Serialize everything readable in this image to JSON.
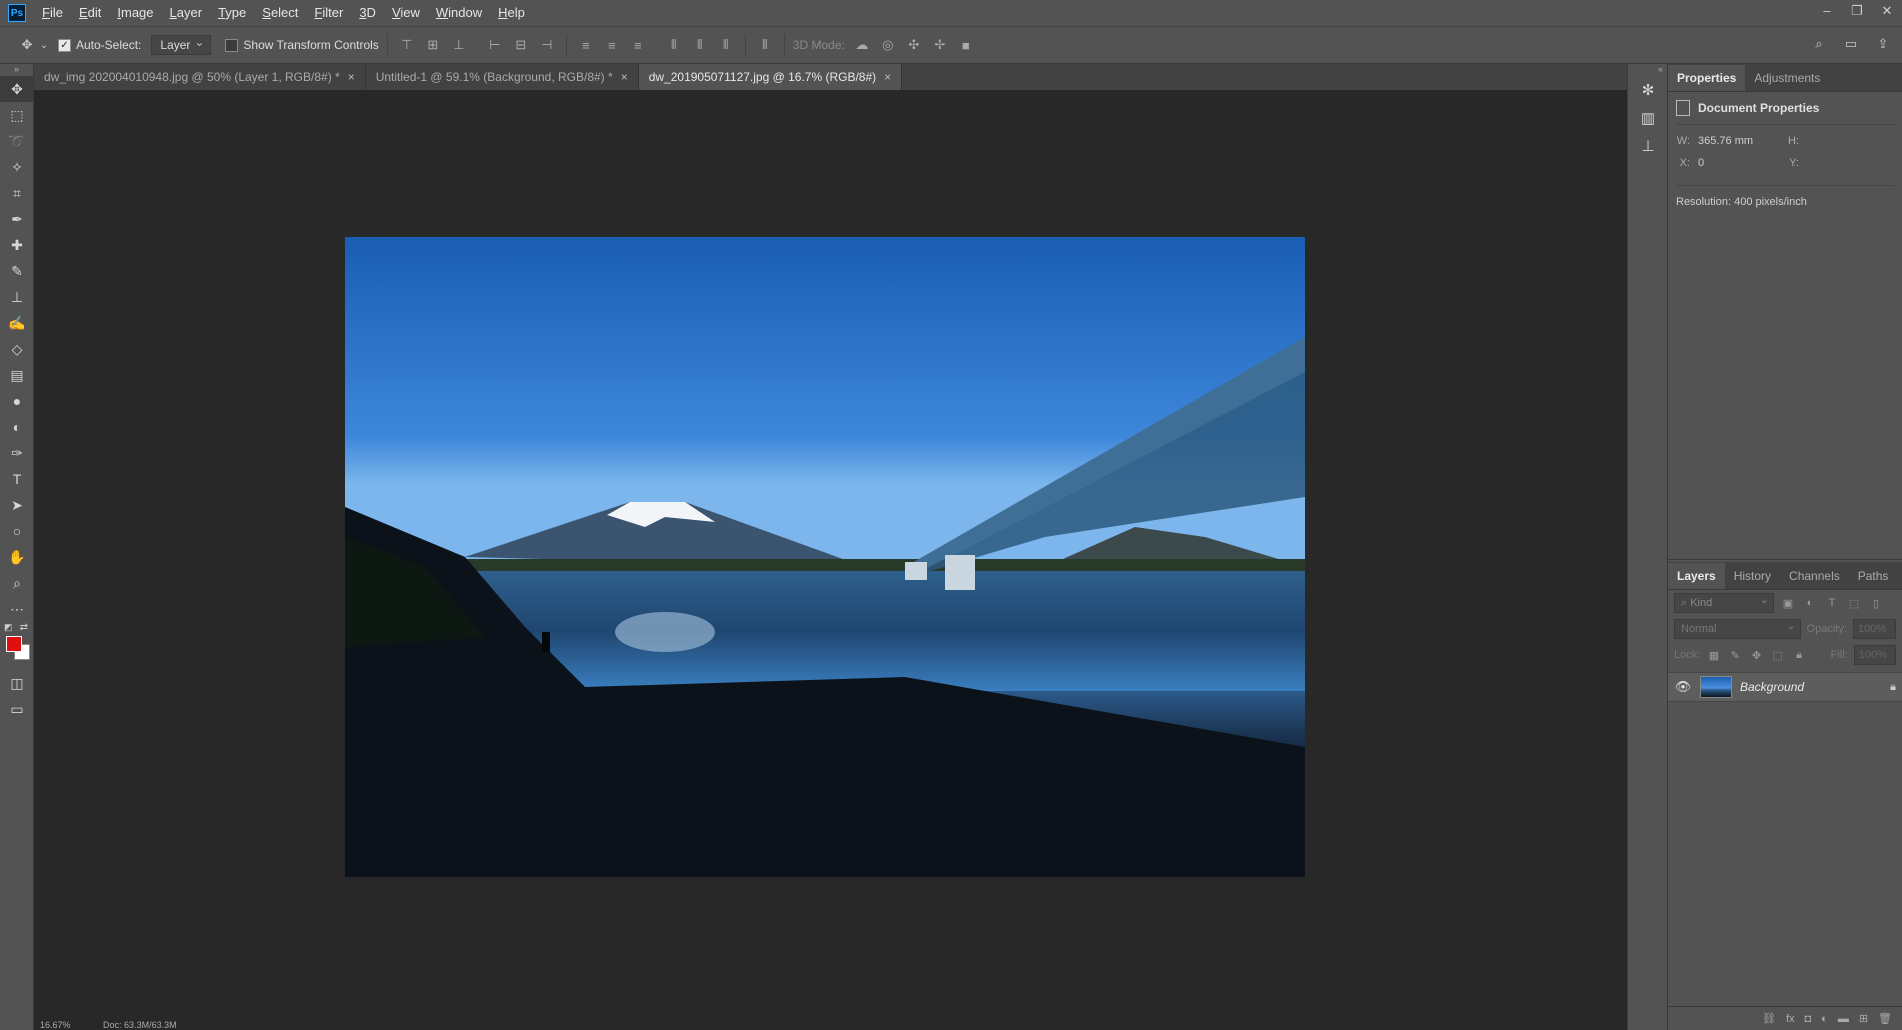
{
  "app": {
    "logo": "Ps"
  },
  "menu": [
    "File",
    "Edit",
    "Image",
    "Layer",
    "Type",
    "Select",
    "Filter",
    "3D",
    "View",
    "Window",
    "Help"
  ],
  "window_controls": {
    "minimize": "–",
    "restore": "❐",
    "close": "✕"
  },
  "options": {
    "auto_select_label": "Auto-Select:",
    "auto_select_checked": true,
    "auto_select_target": "Layer",
    "show_transform_label": "Show Transform Controls",
    "show_transform_checked": false,
    "mode3d_label": "3D Mode:"
  },
  "tabs": [
    {
      "title": "dw_img 202004010948.jpg @ 50% (Layer 1, RGB/8#) *",
      "close": "×",
      "active": false
    },
    {
      "title": "Untitled-1 @ 59.1% (Background, RGB/8#) *",
      "close": "×",
      "active": false
    },
    {
      "title": "dw_201905071127.jpg @ 16.7% (RGB/8#)",
      "close": "×",
      "active": true
    }
  ],
  "status": {
    "zoom": "16.67%",
    "doc": "Doc: 63.3M/63.3M"
  },
  "properties_panel": {
    "tabs": [
      "Properties",
      "Adjustments"
    ],
    "header": "Document Properties",
    "w_label": "W:",
    "w_value": "365.76 mm",
    "h_label": "H:",
    "h_value": "",
    "x_label": "X:",
    "x_value": "0",
    "y_label": "Y:",
    "y_value": "",
    "resolution": "Resolution: 400 pixels/inch"
  },
  "layers_panel": {
    "tabs": [
      "Layers",
      "History",
      "Channels",
      "Paths"
    ],
    "kind_placeholder": "Kind",
    "blend_mode": "Normal",
    "opacity_label": "Opacity:",
    "opacity_value": "100%",
    "lock_label": "Lock:",
    "fill_label": "Fill:",
    "fill_value": "100%",
    "layers": [
      {
        "name": "Background",
        "visible": true,
        "locked": true
      }
    ]
  },
  "colors": {
    "foreground": "#e01010",
    "background": "#ffffff",
    "ui": "#535353",
    "canvas": "#282828"
  }
}
